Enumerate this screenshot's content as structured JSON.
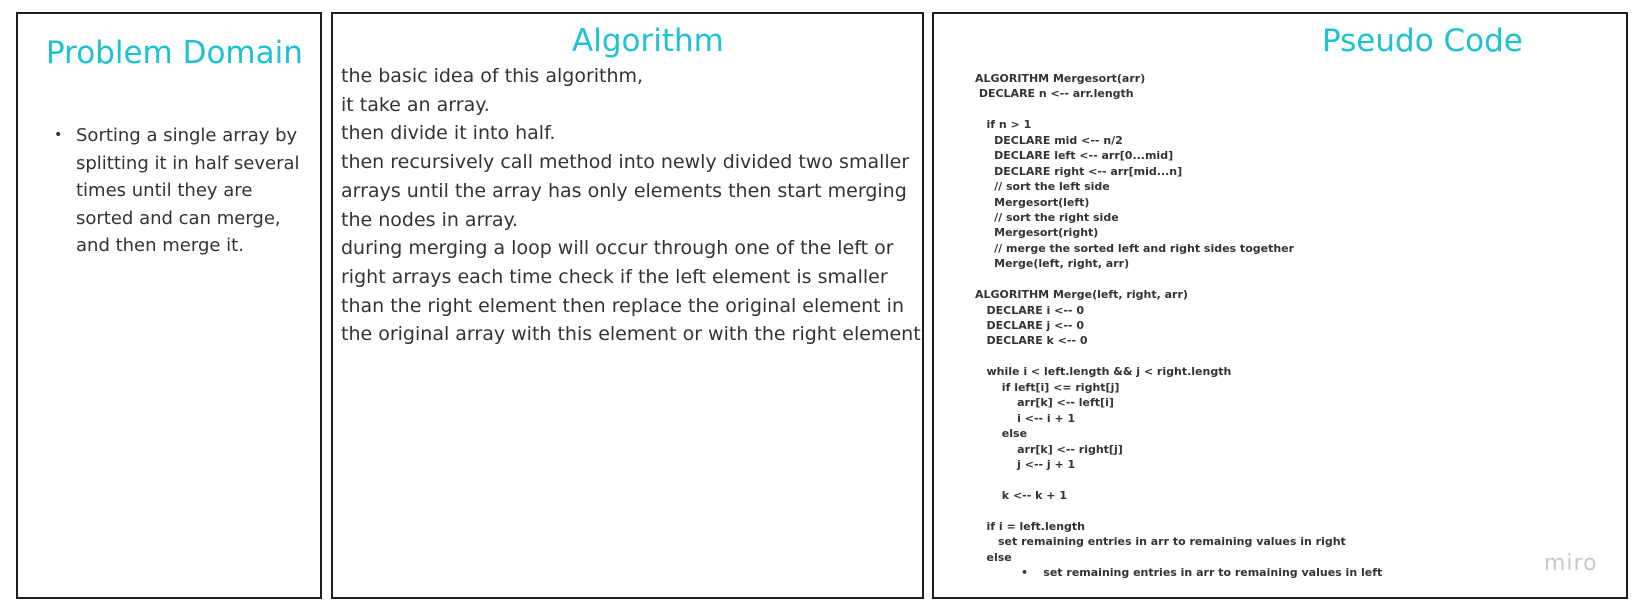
{
  "panels": {
    "problem_domain": {
      "title": "Problem Domain",
      "bullets": [
        "Sorting a single array by splitting it in half several times until they are sorted and can merge, and then merge it."
      ]
    },
    "algorithm": {
      "title": "Algorithm",
      "lines": [
        "the basic idea of this algorithm,",
        "it take an array.",
        "then divide it into half.",
        "then recursively call method into newly divided two smaller arrays until the array has only elements then start merging the nodes in array.",
        "during merging a loop will occur through one of the left or right arrays each time check if the left element is smaller than the right element then replace the original element in the original array with this element or with the right element"
      ]
    },
    "pseudo_code": {
      "title": "Pseudo Code",
      "lines": [
        "ALGORITHM Mergesort(arr)",
        " DECLARE n <-- arr.length",
        "",
        "   if n > 1",
        "     DECLARE mid <-- n/2",
        "     DECLARE left <-- arr[0...mid]",
        "     DECLARE right <-- arr[mid...n]",
        "     // sort the left side",
        "     Mergesort(left)",
        "     // sort the right side",
        "     Mergesort(right)",
        "     // merge the sorted left and right sides together",
        "     Merge(left, right, arr)",
        "",
        "ALGORITHM Merge(left, right, arr)",
        "   DECLARE i <-- 0",
        "   DECLARE j <-- 0",
        "   DECLARE k <-- 0",
        "",
        "   while i < left.length && j < right.length",
        "       if left[i] <= right[j]",
        "           arr[k] <-- left[i]",
        "           i <-- i + 1",
        "       else",
        "           arr[k] <-- right[j]",
        "           j <-- j + 1",
        "",
        "       k <-- k + 1",
        "",
        "   if i = left.length",
        "      set remaining entries in arr to remaining values in right",
        "   else",
        "            •    set remaining entries in arr to remaining values in left"
      ]
    }
  },
  "watermark": "miro",
  "colors": {
    "title": "#1fc2cf",
    "border": "#1f1f1f",
    "text": "#333333",
    "watermark": "#c9c9c9"
  }
}
